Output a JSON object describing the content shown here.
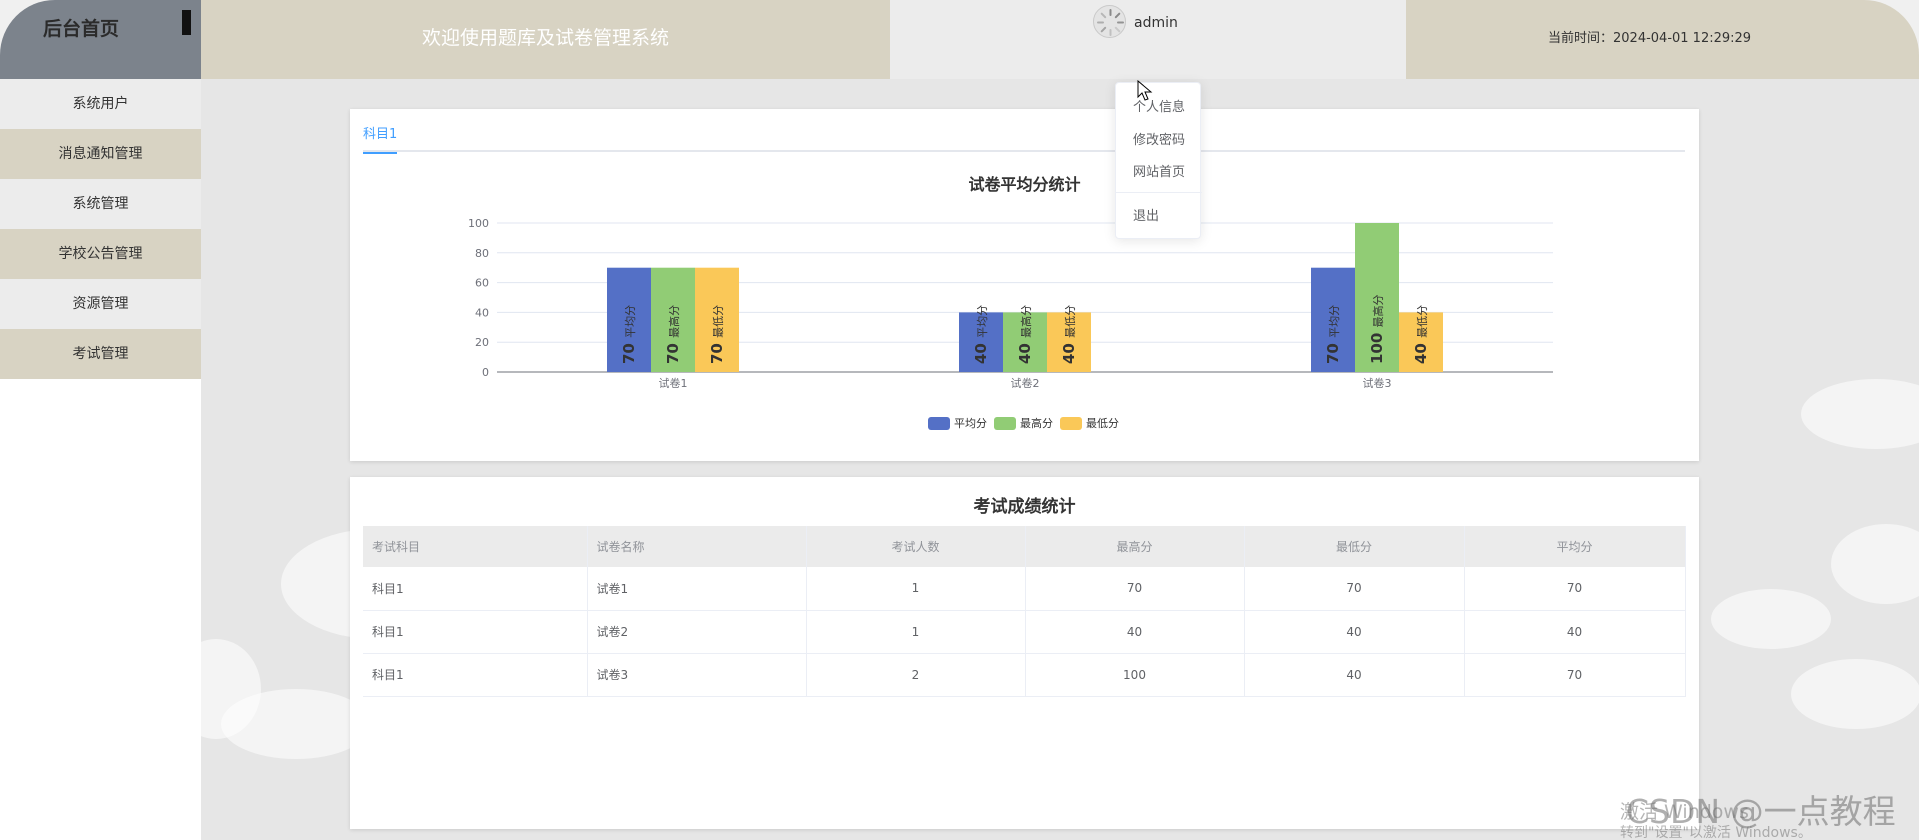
{
  "header": {
    "brand_title": "后台首页",
    "welcome": "欢迎使用题库及试卷管理系统",
    "username": "admin",
    "time": "当前时间：2024-04-01 12:29:29"
  },
  "sidebar": {
    "items": [
      {
        "label": "系统用户"
      },
      {
        "label": "消息通知管理"
      },
      {
        "label": "系统管理"
      },
      {
        "label": "学校公告管理"
      },
      {
        "label": "资源管理"
      },
      {
        "label": "考试管理"
      }
    ]
  },
  "dropdown": {
    "items": [
      "个人信息",
      "修改密码",
      "网站首页",
      "退出"
    ]
  },
  "tabs": [
    "科目1"
  ],
  "chart_data": {
    "type": "bar",
    "title": "试卷平均分统计",
    "categories": [
      "试卷1",
      "试卷2",
      "试卷3"
    ],
    "series": [
      {
        "name": "平均分",
        "values": [
          70,
          40,
          70
        ],
        "color": "#5470c6"
      },
      {
        "name": "最高分",
        "values": [
          70,
          40,
          100
        ],
        "color": "#91cc75"
      },
      {
        "name": "最低分",
        "values": [
          70,
          40,
          40
        ],
        "color": "#fac858"
      }
    ],
    "ylim": [
      0,
      100
    ],
    "yticks": [
      0,
      20,
      40,
      60,
      80,
      100
    ],
    "grid": true,
    "legend": "bottom-center"
  },
  "table": {
    "title": "考试成绩统计",
    "headers": [
      "考试科目",
      "试卷名称",
      "考试人数",
      "最高分",
      "最低分",
      "平均分"
    ],
    "rows": [
      [
        "科目1",
        "试卷1",
        "1",
        "70",
        "70",
        "70"
      ],
      [
        "科目1",
        "试卷2",
        "1",
        "40",
        "40",
        "40"
      ],
      [
        "科目1",
        "试卷3",
        "2",
        "100",
        "40",
        "70"
      ]
    ]
  },
  "watermark": {
    "activate": "激活 Windows",
    "activate_hint": "转到\"设置\"以激活 Windows。",
    "csdn": "CSDN @一点教程"
  }
}
